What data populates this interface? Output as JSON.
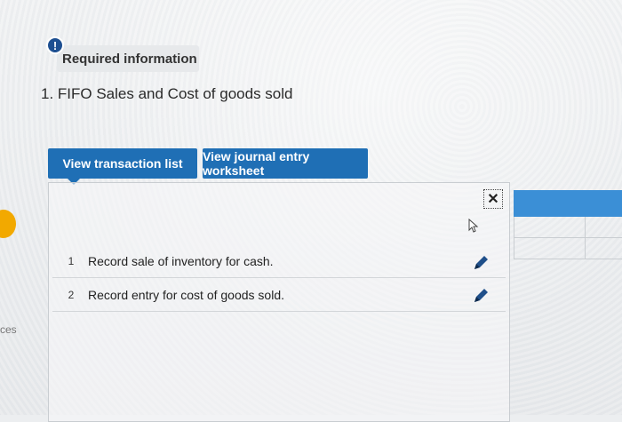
{
  "info": {
    "icon": "!",
    "label": "Required information"
  },
  "question": {
    "text": "1. FIFO Sales and Cost of goods sold"
  },
  "tabs": [
    {
      "label": "View transaction list"
    },
    {
      "label": "View journal entry worksheet"
    }
  ],
  "entries": [
    {
      "number": "1",
      "text": "Record sale of inventory for cash."
    },
    {
      "number": "2",
      "text": "Record entry for cost of goods sold."
    }
  ],
  "left_edge": {
    "text": "ces"
  },
  "side_table": {
    "header_glyph": "["
  },
  "icons": {
    "info": "exclamation-icon",
    "close": "close-icon",
    "cursor": "mouse-cursor-icon",
    "edit": "pencil-icon"
  },
  "colors": {
    "tab_blue": "#1f6fb5",
    "info_badge": "#1d4f91",
    "side_header": "#3b8fd6",
    "left_marker": "#f2a900"
  }
}
